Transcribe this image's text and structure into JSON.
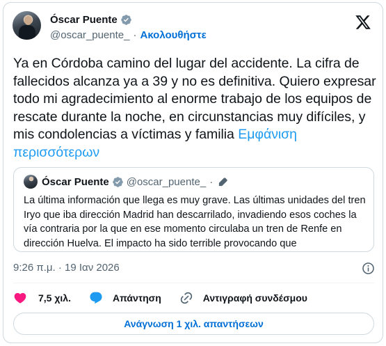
{
  "author": {
    "name": "Óscar Puente",
    "handle": "@oscar_puente_",
    "separator": "·",
    "follow_label": "Ακολουθήστε",
    "verified_icon": "verified-badge-icon"
  },
  "tweet": {
    "text": "Ya en Córdoba camino del lugar del accidente. La cifra de fallecidos alcanza ya a 39 y no es definitiva. Quiero expresar todo mi agradecimiento al enorme trabajo de los equipos de rescate durante la noche, en circunstancias muy difíciles, y mis condolencias a víctimas y familia",
    "show_more_label": "Εμφάνιση περισσότερων"
  },
  "quote": {
    "name": "Óscar Puente",
    "handle": "@oscar_puente_",
    "separator": "·",
    "text": "La última información que llega es muy grave. Las últimas unidades del tren Iryo que iba dirección Madrid han descarrilado, invadiendo esos coches la vía contraria por la que en ese momento circulaba un tren de Renfe en dirección Huelva. El impacto ha sido terrible provocando que"
  },
  "meta": {
    "timestamp": "9:26 π.μ. · 19 Ιαν 2026"
  },
  "actions": {
    "likes_count": "7,5 χιλ.",
    "reply_label": "Απάντηση",
    "copy_link_label": "Αντιγραφή συνδέσμου"
  },
  "read_replies_label": "Ανάγνωση 1 χιλ. απαντήσεων",
  "colors": {
    "accent": "#1d9bf0",
    "link": "#006fd6",
    "like": "#f91880",
    "secondary_text": "#536471",
    "border": "#cfd9de"
  }
}
